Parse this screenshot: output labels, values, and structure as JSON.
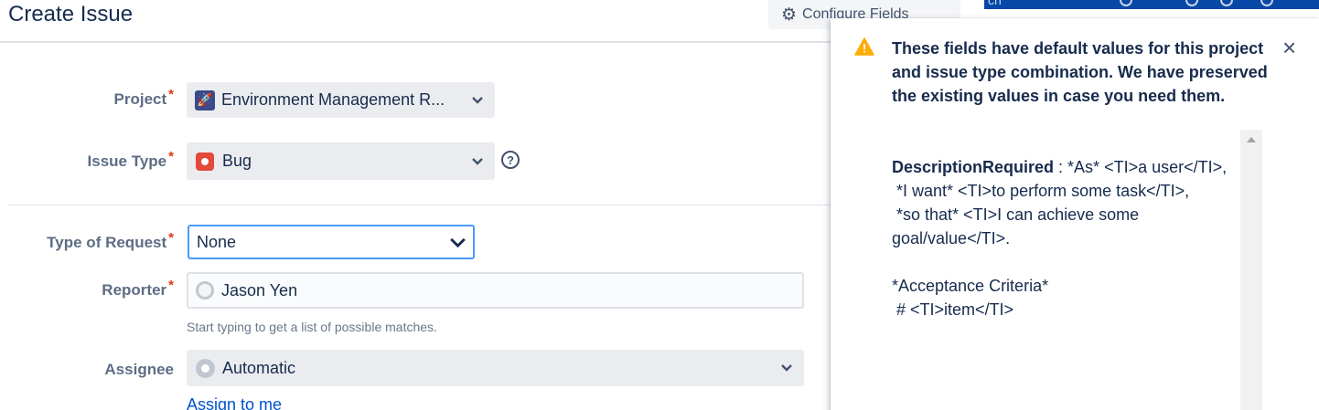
{
  "topbar": {
    "search_text": "ch"
  },
  "dialog": {
    "title": "Create Issue",
    "configure_label": "Configure Fields"
  },
  "fields": {
    "project": {
      "label": "Project",
      "value": "Environment Management R..."
    },
    "issue_type": {
      "label": "Issue Type",
      "value": "Bug",
      "help": "?"
    },
    "type_of_request": {
      "label": "Type of Request",
      "value": "None"
    },
    "reporter": {
      "label": "Reporter",
      "value": "Jason Yen",
      "hint": "Start typing to get a list of possible matches."
    },
    "assignee": {
      "label": "Assignee",
      "value": "Automatic",
      "assign_link": "Assign to me"
    }
  },
  "required_marker": "*",
  "flag": {
    "title": "These fields have default values for this project and issue type combination. We have preserved the existing values in case you need them.",
    "field_name": "DescriptionRequired",
    "separator": " : ",
    "field_value": "*As* <TI>a user</TI>,\n *I want* <TI>to perform some task</TI>,\n *so that* <TI>I can achieve some goal/value</TI>.\n\n*Acceptance Criteria*\n # <TI>item</TI>",
    "close": "×",
    "colors": {
      "warning": "#ffab00"
    }
  }
}
